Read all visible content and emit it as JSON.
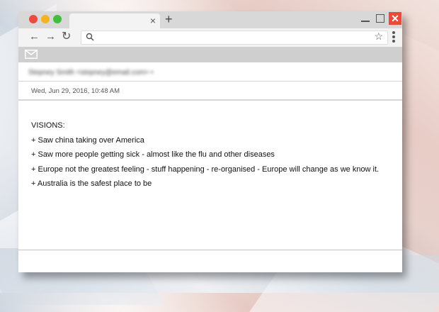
{
  "browser": {
    "tab_close": "×",
    "new_tab": "+",
    "close_window": "✕",
    "back": "←",
    "forward": "→",
    "reload": "↻",
    "address": {
      "value": "",
      "placeholder": ""
    },
    "star": "☆"
  },
  "email": {
    "sender_name": "Stepney Smith",
    "sender_email": "<stepney@email.com>",
    "sender_mark": "•",
    "date": "Wed, Jun 29, 2016, 10:48 AM",
    "body_lines": [
      "VISIONS:",
      "+ Saw china taking over America",
      "+ Saw more people getting sick - almost like the flu and other diseases",
      "+ Europe not the greatest feeling - stuff happening - re-organised - Europe will change as we know it.",
      "+ Australia is the safest place to be"
    ]
  },
  "colors": {
    "close_red": "#ee4b3f",
    "minimize_yellow": "#f5b323",
    "zoom_green": "#3fbf3b",
    "window_close": "#e84b3c"
  }
}
